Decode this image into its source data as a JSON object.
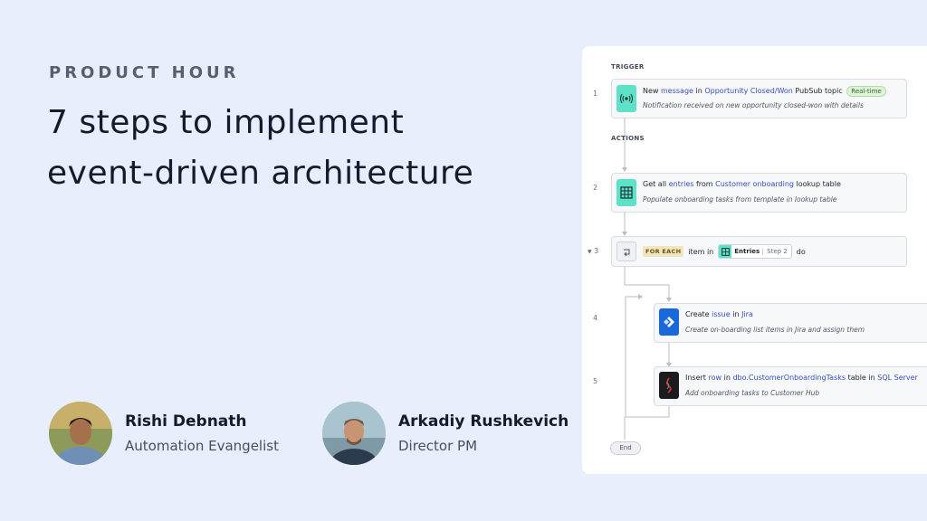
{
  "header": {
    "eyebrow": "PRODUCT HOUR",
    "title_line1": "7 steps to implement",
    "title_line2": "event-driven architecture"
  },
  "speakers": [
    {
      "name": "Rishi Debnath",
      "role": "Automation Evangelist"
    },
    {
      "name": "Arkadiy Rushkevich",
      "role": "Director PM"
    }
  ],
  "recipe": {
    "trigger_label": "TRIGGER",
    "actions_label": "ACTIONS",
    "steps": [
      {
        "num": "1",
        "icon": "pubsub-icon",
        "t1": "New ",
        "k1": "message",
        "t2": " in ",
        "k2": "Opportunity Closed/Won",
        "t3": " PubSub topic",
        "badge": "Real-time",
        "subtitle": "Notification received on new opportunity closed-won with details"
      },
      {
        "num": "2",
        "icon": "lookup-table-icon",
        "t1": "Get all ",
        "k1": "entries",
        "t2": " from ",
        "k2": "Customer onboarding",
        "t3": " lookup table",
        "subtitle": "Populate onboarding tasks from template in lookup table"
      },
      {
        "num": "3",
        "icon": "repeat-icon",
        "foreach": "FOR EACH",
        "t1": "item in",
        "pill_name": "Entries",
        "pill_step": "Step 2",
        "t2": "do"
      },
      {
        "num": "4",
        "icon": "jira-icon",
        "t1": "Create ",
        "k1": "issue",
        "t2": " in ",
        "k2": "Jira",
        "subtitle": "Create on-boarding list items in Jira and assign them"
      },
      {
        "num": "5",
        "icon": "sql-server-icon",
        "t1": "Insert ",
        "k1": "row",
        "t2": " in ",
        "k2": "dbo.CustomerOnboardingTasks",
        "t3": " table in ",
        "k3": "SQL Server",
        "subtitle": "Add onboarding tasks to Customer Hub"
      }
    ],
    "end_label": "End"
  },
  "colors": {
    "background": "#e9eefd",
    "accent_teal": "#5ee1c9",
    "keyword_blue": "#3651b7",
    "jira_blue": "#1868db"
  }
}
